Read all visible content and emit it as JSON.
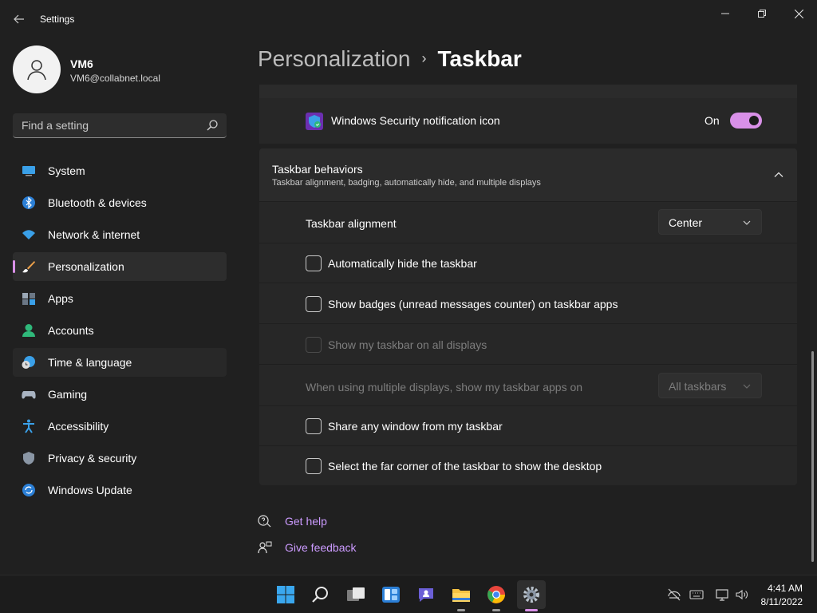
{
  "window": {
    "title": "Settings"
  },
  "user": {
    "name": "VM6",
    "email": "VM6@collabnet.local"
  },
  "search": {
    "placeholder": "Find a setting"
  },
  "nav": {
    "items": [
      {
        "label": "System",
        "icon": "system-icon"
      },
      {
        "label": "Bluetooth & devices",
        "icon": "bluetooth-icon"
      },
      {
        "label": "Network & internet",
        "icon": "wifi-icon"
      },
      {
        "label": "Personalization",
        "icon": "brush-icon",
        "active": true
      },
      {
        "label": "Apps",
        "icon": "apps-icon"
      },
      {
        "label": "Accounts",
        "icon": "accounts-icon"
      },
      {
        "label": "Time & language",
        "icon": "globe-clock-icon",
        "hover": true
      },
      {
        "label": "Gaming",
        "icon": "gamepad-icon"
      },
      {
        "label": "Accessibility",
        "icon": "accessibility-icon"
      },
      {
        "label": "Privacy & security",
        "icon": "shield-icon"
      },
      {
        "label": "Windows Update",
        "icon": "update-icon"
      }
    ]
  },
  "header": {
    "parent": "Personalization",
    "separator": "›",
    "current": "Taskbar"
  },
  "security_row": {
    "label": "Windows Security notification icon",
    "toggle_text": "On",
    "toggle_on": true
  },
  "behaviors": {
    "title": "Taskbar behaviors",
    "subtitle": "Taskbar alignment, badging, automatically hide, and multiple displays",
    "alignment": {
      "label": "Taskbar alignment",
      "value": "Center"
    },
    "auto_hide": {
      "label": "Automatically hide the taskbar",
      "checked": false
    },
    "badges": {
      "label": "Show badges (unread messages counter) on taskbar apps",
      "checked": false
    },
    "all_displays": {
      "label": "Show my taskbar on all displays",
      "checked": false,
      "disabled": true
    },
    "multi_display": {
      "label": "When using multiple displays, show my taskbar apps on",
      "value": "All taskbars",
      "disabled": true
    },
    "share_window": {
      "label": "Share any window from my taskbar",
      "checked": false
    },
    "far_corner": {
      "label": "Select the far corner of the taskbar to show the desktop",
      "checked": false
    }
  },
  "help": {
    "get_help": "Get help",
    "give_feedback": "Give feedback"
  },
  "taskbar": {
    "apps": [
      "start-icon",
      "search-icon",
      "task-view-icon",
      "widgets-icon",
      "chat-icon",
      "file-explorer-icon",
      "chrome-icon",
      "settings-icon"
    ],
    "time": "4:41 AM",
    "date": "8/11/2022"
  },
  "colors": {
    "accent": "#d990e8",
    "link": "#cc9bff",
    "background": "#202020",
    "card": "#2b2b2b"
  }
}
